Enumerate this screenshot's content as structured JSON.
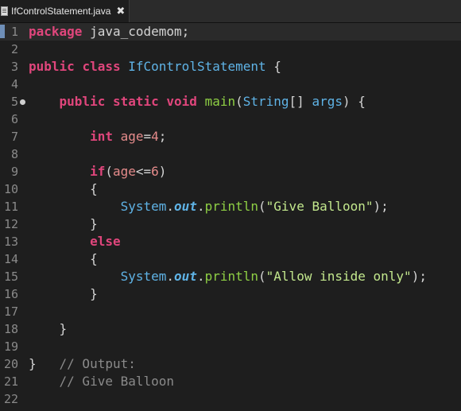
{
  "tab": {
    "label": "IfControlStatement.java",
    "close": "✖"
  },
  "lines": [
    {
      "n": "1",
      "parts": [
        [
          "kw",
          "package"
        ],
        [
          "plain",
          " java_codemom;"
        ]
      ]
    },
    {
      "n": "2",
      "parts": []
    },
    {
      "n": "3",
      "parts": [
        [
          "kw",
          "public"
        ],
        [
          "plain",
          " "
        ],
        [
          "kw",
          "class"
        ],
        [
          "plain",
          " "
        ],
        [
          "cls",
          "IfControlStatement"
        ],
        [
          "plain",
          " {"
        ]
      ]
    },
    {
      "n": "4",
      "parts": []
    },
    {
      "n": "5",
      "parts": [
        [
          "plain",
          "    "
        ],
        [
          "kw",
          "public"
        ],
        [
          "plain",
          " "
        ],
        [
          "kw",
          "static"
        ],
        [
          "plain",
          " "
        ],
        [
          "kw",
          "void"
        ],
        [
          "plain",
          " "
        ],
        [
          "mth",
          "main"
        ],
        [
          "plain",
          "("
        ],
        [
          "cls",
          "String"
        ],
        [
          "plain",
          "[] "
        ],
        [
          "cls",
          "args"
        ],
        [
          "plain",
          ") {"
        ]
      ]
    },
    {
      "n": "6",
      "parts": []
    },
    {
      "n": "7",
      "parts": [
        [
          "plain",
          "        "
        ],
        [
          "kw",
          "int"
        ],
        [
          "plain",
          " "
        ],
        [
          "var",
          "age"
        ],
        [
          "plain",
          "="
        ],
        [
          "num",
          "4"
        ],
        [
          "plain",
          ";"
        ]
      ]
    },
    {
      "n": "8",
      "parts": []
    },
    {
      "n": "9",
      "parts": [
        [
          "plain",
          "        "
        ],
        [
          "kw",
          "if"
        ],
        [
          "plain",
          "("
        ],
        [
          "var",
          "age"
        ],
        [
          "plain",
          "<="
        ],
        [
          "num",
          "6"
        ],
        [
          "plain",
          ")"
        ]
      ]
    },
    {
      "n": "10",
      "parts": [
        [
          "plain",
          "        {"
        ]
      ]
    },
    {
      "n": "11",
      "parts": [
        [
          "plain",
          "            "
        ],
        [
          "cls",
          "System"
        ],
        [
          "plain",
          "."
        ],
        [
          "fld",
          "out"
        ],
        [
          "plain",
          "."
        ],
        [
          "mth",
          "println"
        ],
        [
          "plain",
          "("
        ],
        [
          "str",
          "\"Give Balloon\""
        ],
        [
          "plain",
          ");"
        ]
      ]
    },
    {
      "n": "12",
      "parts": [
        [
          "plain",
          "        }"
        ]
      ]
    },
    {
      "n": "13",
      "parts": [
        [
          "plain",
          "        "
        ],
        [
          "kw",
          "else"
        ]
      ]
    },
    {
      "n": "14",
      "parts": [
        [
          "plain",
          "        {"
        ]
      ]
    },
    {
      "n": "15",
      "parts": [
        [
          "plain",
          "            "
        ],
        [
          "cls",
          "System"
        ],
        [
          "plain",
          "."
        ],
        [
          "fld",
          "out"
        ],
        [
          "plain",
          "."
        ],
        [
          "mth",
          "println"
        ],
        [
          "plain",
          "("
        ],
        [
          "str",
          "\"Allow inside only\""
        ],
        [
          "plain",
          ");"
        ]
      ]
    },
    {
      "n": "16",
      "parts": [
        [
          "plain",
          "        }"
        ]
      ]
    },
    {
      "n": "17",
      "parts": []
    },
    {
      "n": "18",
      "parts": [
        [
          "plain",
          "    }"
        ]
      ]
    },
    {
      "n": "19",
      "parts": []
    },
    {
      "n": "20",
      "parts": [
        [
          "plain",
          "}   "
        ],
        [
          "cmt",
          "// Output:"
        ]
      ]
    },
    {
      "n": "21",
      "parts": [
        [
          "plain",
          "    "
        ],
        [
          "cmt",
          "// Give Balloon"
        ]
      ]
    },
    {
      "n": "22",
      "parts": []
    }
  ],
  "current_line": "1",
  "fold_line": "5",
  "colors": {
    "keyword": "#e0467c",
    "type": "#5fb3e6",
    "method": "#8ecf44",
    "variable": "#e58b8b",
    "string": "#c3e88d",
    "comment": "#8a8a8a",
    "background": "#1e1e1e"
  },
  "icons": {
    "tab_icon": "java-file-icon",
    "fold": "fold-marker-icon"
  }
}
